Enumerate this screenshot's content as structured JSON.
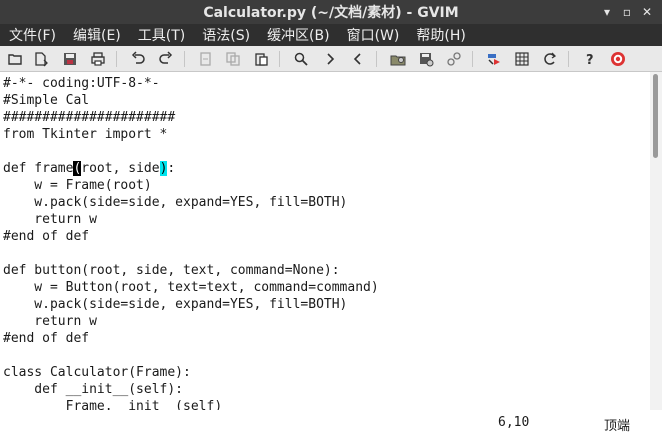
{
  "window": {
    "title": "Calculator.py (~/文档/素材) - GVIM",
    "min_label": "▾",
    "max_label": "▫",
    "close_label": "✕"
  },
  "menu": [
    "文件(F)",
    "编辑(E)",
    "工具(T)",
    "语法(S)",
    "缓冲区(B)",
    "窗口(W)",
    "帮助(H)"
  ],
  "toolbar_icons": [
    "open-file-icon",
    "load-session-icon",
    "save-icon",
    "print-icon",
    "undo-icon",
    "redo-icon",
    "cut-icon",
    "copy-icon",
    "paste-icon",
    "find-icon",
    "find-next-icon",
    "find-prev-icon",
    "load-script-icon",
    "save-session-icon",
    "run-script-icon",
    "make-icon",
    "ctags-icon",
    "tag-jump-icon",
    "help-icon",
    "find-help-icon"
  ],
  "code": {
    "lines": [
      "#-*- coding:UTF-8-*-",
      "#Simple Cal",
      "######################",
      "from Tkinter import *",
      "",
      "",
      "    w = Frame(root)",
      "    w.pack(side=side, expand=YES, fill=BOTH)",
      "    return w",
      "#end of def",
      "",
      "def button(root, side, text, command=None):",
      "    w = Button(root, text=text, command=command)",
      "    w.pack(side=side, expand=YES, fill=BOTH)",
      "    return w",
      "#end of def",
      "",
      "class Calculator(Frame):",
      "    def __init__(self):",
      "        Frame.__init__(self)"
    ],
    "cursor_line": {
      "before": "def frame",
      "cursor_char": "(",
      "middle": "root, side",
      "match_char": ")",
      "after": ":"
    }
  },
  "status": {
    "position": "6,10",
    "location": "顶端"
  },
  "colors": {
    "cursor": "#000000",
    "paren_match": "#00e5ee"
  }
}
